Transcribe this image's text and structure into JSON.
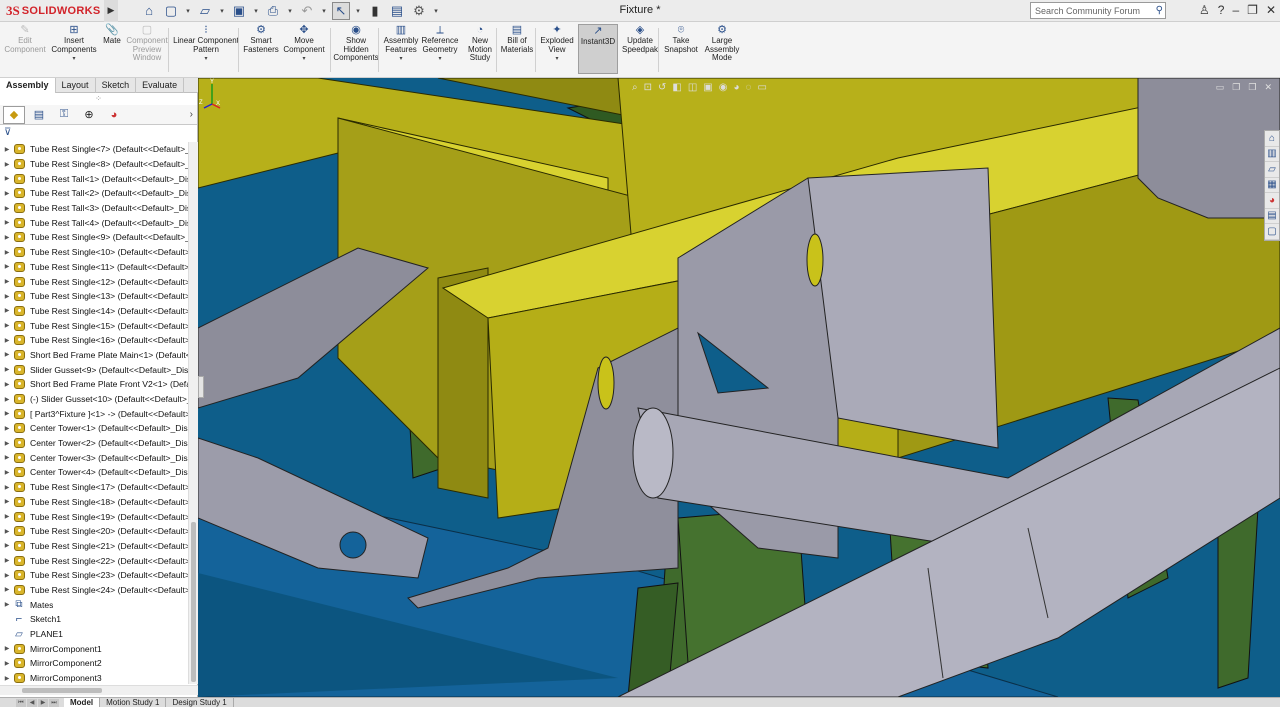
{
  "app": {
    "ds_mark": "3S",
    "brand": "SOLIDWORKS",
    "document_title": "Fixture *"
  },
  "search": {
    "placeholder": "Search Community Forum"
  },
  "commands": [
    {
      "id": "edit-component",
      "label": [
        "Edit",
        "Component"
      ],
      "icon": "edit-component-icon",
      "disabled": true,
      "dropdown": false
    },
    {
      "id": "insert-components",
      "label": [
        "Insert",
        "Components"
      ],
      "icon": "insert-components-icon",
      "disabled": false,
      "dropdown": true
    },
    {
      "id": "mate",
      "label": [
        "Mate"
      ],
      "icon": "mate-icon",
      "disabled": false,
      "dropdown": false
    },
    {
      "id": "component-preview-window",
      "label": [
        "Component",
        "Preview",
        "Window"
      ],
      "icon": "preview-window-icon",
      "disabled": true,
      "dropdown": false
    },
    {
      "id": "linear-component-pattern",
      "label": [
        "Linear Component",
        "Pattern"
      ],
      "icon": "linear-pattern-icon",
      "disabled": false,
      "dropdown": true
    },
    {
      "id": "smart-fasteners",
      "label": [
        "Smart",
        "Fasteners"
      ],
      "icon": "smart-fasteners-icon",
      "disabled": false,
      "dropdown": false
    },
    {
      "id": "move-component",
      "label": [
        "Move",
        "Component"
      ],
      "icon": "move-component-icon",
      "disabled": false,
      "dropdown": true
    },
    {
      "id": "show-hidden-components",
      "label": [
        "Show",
        "Hidden",
        "Components"
      ],
      "icon": "show-hidden-icon",
      "disabled": false,
      "dropdown": false
    },
    {
      "id": "assembly-features",
      "label": [
        "Assembly",
        "Features"
      ],
      "icon": "assembly-features-icon",
      "disabled": false,
      "dropdown": true
    },
    {
      "id": "reference-geometry",
      "label": [
        "Reference",
        "Geometry"
      ],
      "icon": "reference-geometry-icon",
      "disabled": false,
      "dropdown": true
    },
    {
      "id": "new-motion-study",
      "label": [
        "New",
        "Motion",
        "Study"
      ],
      "icon": "motion-study-icon",
      "disabled": false,
      "dropdown": false
    },
    {
      "id": "bill-of-materials",
      "label": [
        "Bill of",
        "Materials"
      ],
      "icon": "bom-icon",
      "disabled": false,
      "dropdown": false
    },
    {
      "id": "exploded-view",
      "label": [
        "Exploded",
        "View"
      ],
      "icon": "exploded-view-icon",
      "disabled": false,
      "dropdown": true
    },
    {
      "id": "instant3d",
      "label": [
        "Instant3D"
      ],
      "icon": "instant3d-icon",
      "disabled": false,
      "dropdown": false,
      "active": true
    },
    {
      "id": "update-speedpak",
      "label": [
        "Update",
        "Speedpak"
      ],
      "icon": "speedpak-icon",
      "disabled": false,
      "dropdown": false
    },
    {
      "id": "take-snapshot",
      "label": [
        "Take",
        "Snapshot"
      ],
      "icon": "camera-icon",
      "disabled": false,
      "dropdown": false
    },
    {
      "id": "large-assembly-mode",
      "label": [
        "Large",
        "Assembly",
        "Mode"
      ],
      "icon": "large-assembly-icon",
      "disabled": false,
      "dropdown": false
    }
  ],
  "tabs": [
    "Assembly",
    "Layout",
    "Sketch",
    "Evaluate"
  ],
  "active_tab": "Assembly",
  "tree": [
    {
      "label": "Tube Rest Single<7> (Default<<Default>_Di",
      "type": "part"
    },
    {
      "label": "Tube Rest Single<8> (Default<<Default>_Di",
      "type": "part"
    },
    {
      "label": "Tube Rest Tall<1> (Default<<Default>_Displ",
      "type": "part"
    },
    {
      "label": "Tube Rest Tall<2> (Default<<Default>_Displ",
      "type": "part"
    },
    {
      "label": "Tube Rest Tall<3> (Default<<Default>_Displ",
      "type": "part"
    },
    {
      "label": "Tube Rest Tall<4> (Default<<Default>_Displ",
      "type": "part"
    },
    {
      "label": "Tube Rest Single<9> (Default<<Default>_Di",
      "type": "part"
    },
    {
      "label": "Tube Rest Single<10> (Default<<Default>_D",
      "type": "part"
    },
    {
      "label": "Tube Rest Single<11> (Default<<Default>_D",
      "type": "part"
    },
    {
      "label": "Tube Rest Single<12> (Default<<Default>_D",
      "type": "part"
    },
    {
      "label": "Tube Rest Single<13> (Default<<Default>_D",
      "type": "part"
    },
    {
      "label": "Tube Rest Single<14> (Default<<Default>_D",
      "type": "part"
    },
    {
      "label": "Tube Rest Single<15> (Default<<Default>_D",
      "type": "part"
    },
    {
      "label": "Tube Rest Single<16> (Default<<Default>_D",
      "type": "part"
    },
    {
      "label": "Short Bed Frame Plate Main<1> (Default<<D",
      "type": "part"
    },
    {
      "label": "Slider Gusset<9> (Default<<Default>_Displa",
      "type": "part"
    },
    {
      "label": "Short Bed Frame Plate Front V2<1> (Default-",
      "type": "part"
    },
    {
      "label": "(-) Slider Gusset<10> (Default<<Default>_Di",
      "type": "part"
    },
    {
      "label": "[ Part3^Fixture ]<1> -> (Default<<Default>_",
      "type": "part"
    },
    {
      "label": "Center Tower<1> (Default<<Default>_Displa",
      "type": "part"
    },
    {
      "label": "Center Tower<2> (Default<<Default>_Displa",
      "type": "part"
    },
    {
      "label": "Center Tower<3> (Default<<Default>_Displa",
      "type": "part"
    },
    {
      "label": "Center Tower<4> (Default<<Default>_Displa",
      "type": "part"
    },
    {
      "label": "Tube Rest Single<17> (Default<<Default>_D",
      "type": "part"
    },
    {
      "label": "Tube Rest Single<18> (Default<<Default>_D",
      "type": "part"
    },
    {
      "label": "Tube Rest Single<19> (Default<<Default>_D",
      "type": "part"
    },
    {
      "label": "Tube Rest Single<20> (Default<<Default>_D",
      "type": "part"
    },
    {
      "label": "Tube Rest Single<21> (Default<<Default>_D",
      "type": "part"
    },
    {
      "label": "Tube Rest Single<22> (Default<<Default>_D",
      "type": "part"
    },
    {
      "label": "Tube Rest Single<23> (Default<<Default>_D",
      "type": "part"
    },
    {
      "label": "Tube Rest Single<24> (Default<<Default>_D",
      "type": "part"
    },
    {
      "label": "Mates",
      "type": "mates"
    },
    {
      "label": "Sketch1",
      "type": "sketch"
    },
    {
      "label": "PLANE1",
      "type": "plane"
    },
    {
      "label": "MirrorComponent1",
      "type": "mirror"
    },
    {
      "label": "MirrorComponent2",
      "type": "mirror"
    },
    {
      "label": "MirrorComponent3",
      "type": "mirror"
    }
  ],
  "bottom_tabs": [
    "Model",
    "Motion Study 1",
    "Design Study 1"
  ],
  "active_bottom_tab": "Model",
  "triad": {
    "x": "X",
    "y": "Y",
    "z": "Z"
  },
  "colors": {
    "brand": "#d2232a",
    "viewport_bg": "#0e5e8a",
    "yellow_part": "#c9c21a",
    "gray_part": "#9a9aa8",
    "green_part": "#3f6a2c"
  }
}
